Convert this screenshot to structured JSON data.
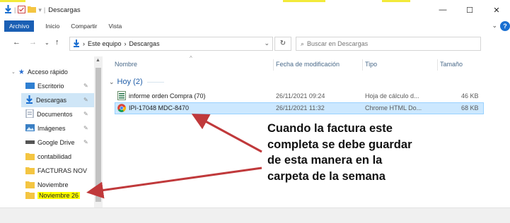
{
  "window": {
    "title": "Descargas",
    "controls": {
      "minimize": "—",
      "maximize": "☐",
      "close": "✕"
    }
  },
  "ribbon": {
    "tabs": [
      "Archivo",
      "Inicio",
      "Compartir",
      "Vista"
    ],
    "collapse_chevron": "⌄",
    "help": "?"
  },
  "address_bar": {
    "path": [
      "Este equipo",
      "Descargas"
    ],
    "search_placeholder": "Buscar en Descargas"
  },
  "navigation_pane": {
    "quick_access_label": "Acceso rápido",
    "items": [
      {
        "label": "Escritorio",
        "icon": "desktop-icon",
        "pinned": true
      },
      {
        "label": "Descargas",
        "icon": "download-icon",
        "pinned": true,
        "selected": true
      },
      {
        "label": "Documentos",
        "icon": "documents-icon",
        "pinned": true
      },
      {
        "label": "Imágenes",
        "icon": "pictures-icon",
        "pinned": true
      },
      {
        "label": "Google Drive",
        "icon": "google-drive-icon",
        "pinned": true
      },
      {
        "label": "contabilidad",
        "icon": "folder-icon",
        "pinned": false
      },
      {
        "label": "FACTURAS NOV",
        "icon": "folder-icon",
        "pinned": false
      },
      {
        "label": "Noviembre",
        "icon": "folder-icon",
        "pinned": false
      },
      {
        "label": "Noviembre 26",
        "icon": "folder-icon",
        "pinned": false,
        "highlighted": true
      }
    ]
  },
  "file_list": {
    "columns": [
      "Nombre",
      "Fecha de modificación",
      "Tipo",
      "Tamaño"
    ],
    "group_label": "Hoy (2)",
    "rows": [
      {
        "name": "informe orden Compra (70)",
        "date": "26/11/2021 09:24",
        "type": "Hoja de cálculo d...",
        "size": "46 KB",
        "icon": "spreadsheet-icon"
      },
      {
        "name": "IPI-17048 MDC-8470",
        "date": "26/11/2021 11:32",
        "type": "Chrome HTML Do...",
        "size": "68 KB",
        "icon": "chrome-icon",
        "selected": true
      }
    ]
  },
  "annotation": {
    "lines": [
      "Cuando la factura este",
      "completa se debe guardar",
      "de esta manera en la",
      "carpeta de la semana"
    ],
    "arrow_color": "#c0393b"
  },
  "colors": {
    "accent": "#1a5fb4",
    "selection": "#cce8ff",
    "highlight": "#ffff00"
  }
}
